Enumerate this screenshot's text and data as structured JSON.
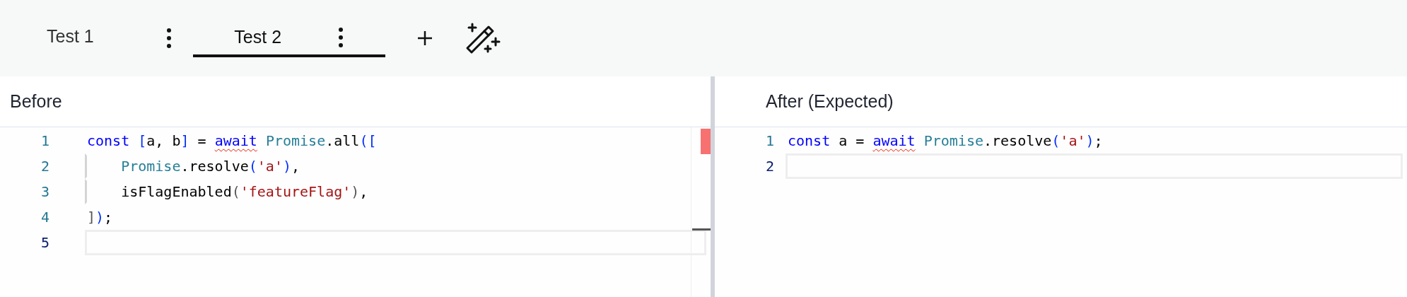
{
  "tabs": [
    {
      "label": "Test 1",
      "selected": false
    },
    {
      "label": "Test 2",
      "selected": true
    }
  ],
  "panes": [
    {
      "title": "Before",
      "lines": [
        {
          "number": "1",
          "active": false,
          "tokens": [
            {
              "kind": "keyword",
              "text": "const"
            },
            {
              "kind": "bracket",
              "text": " ["
            },
            {
              "kind": "plain",
              "text": "a, b"
            },
            {
              "kind": "bracket",
              "text": "]"
            },
            {
              "kind": "plain",
              "text": " = "
            },
            {
              "kind": "keyword",
              "text": "await",
              "error": true
            },
            {
              "kind": "type",
              "text": " Promise"
            },
            {
              "kind": "plain",
              "text": ".all"
            },
            {
              "kind": "bracket",
              "text": "(["
            }
          ]
        },
        {
          "number": "2",
          "active": false,
          "tokens": [
            {
              "kind": "type",
              "text": "    Promise"
            },
            {
              "kind": "plain",
              "text": ".resolve"
            },
            {
              "kind": "bracket",
              "text": "("
            },
            {
              "kind": "string",
              "text": "'a'"
            },
            {
              "kind": "bracket",
              "text": ")"
            },
            {
              "kind": "plain",
              "text": ","
            }
          ]
        },
        {
          "number": "3",
          "active": false,
          "tokens": [
            {
              "kind": "plain",
              "text": "    isFlagEnabled"
            },
            {
              "kind": "paren",
              "text": "("
            },
            {
              "kind": "string",
              "text": "'featureFlag'"
            },
            {
              "kind": "paren",
              "text": ")"
            },
            {
              "kind": "plain",
              "text": ","
            }
          ]
        },
        {
          "number": "4",
          "active": false,
          "tokens": [
            {
              "kind": "paren",
              "text": "]"
            },
            {
              "kind": "bracket",
              "text": ")"
            },
            {
              "kind": "plain",
              "text": ";"
            }
          ]
        },
        {
          "number": "5",
          "active": true
        }
      ]
    },
    {
      "title": "After (Expected)",
      "lines": [
        {
          "number": "1",
          "active": false,
          "tokens": [
            {
              "kind": "keyword",
              "text": "const"
            },
            {
              "kind": "plain",
              "text": " a = "
            },
            {
              "kind": "keyword",
              "text": "await",
              "error": true
            },
            {
              "kind": "type",
              "text": " Promise"
            },
            {
              "kind": "plain",
              "text": ".resolve"
            },
            {
              "kind": "bracket",
              "text": "("
            },
            {
              "kind": "string",
              "text": "'a'"
            },
            {
              "kind": "bracket",
              "text": ")"
            },
            {
              "kind": "plain",
              "text": ";"
            }
          ]
        },
        {
          "number": "2",
          "active": true
        }
      ]
    }
  ]
}
